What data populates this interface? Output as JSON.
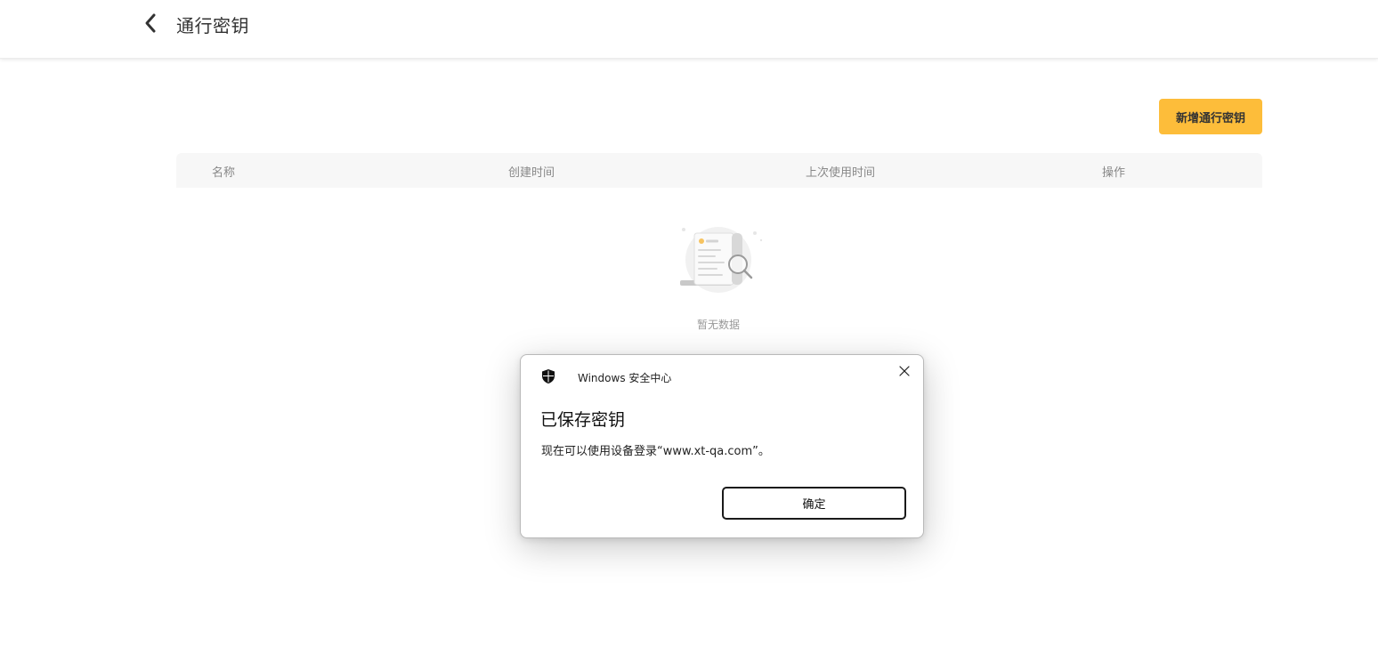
{
  "header": {
    "title": "通行密钥",
    "back_icon": "chevron-left-icon"
  },
  "toolbar": {
    "add_label": "新增通行密钥",
    "accent_color": "#fdbd3a"
  },
  "table": {
    "columns": [
      "名称",
      "创建时间",
      "上次使用时间",
      "操作"
    ],
    "rows": [],
    "empty_text": "暂无数据",
    "empty_icon": "empty-document-search-icon"
  },
  "dialog": {
    "app_name": "Windows 安全中心",
    "app_icon": "shield-icon",
    "title": "已保存密钥",
    "message": "现在可以使用设备登录“www.xt-qa.com”。",
    "ok_label": "确定",
    "close_icon": "close-icon"
  }
}
